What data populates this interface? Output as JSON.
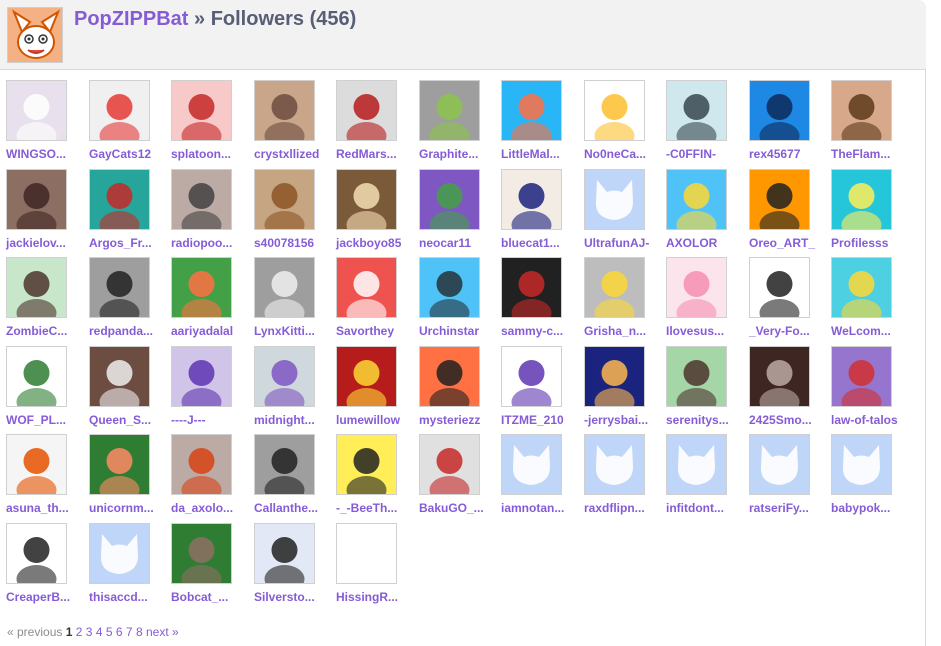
{
  "header": {
    "username": "PopZIPPBat",
    "title_rest": " » Followers (456)",
    "avatar_icon": "cartoon-bat-avatar"
  },
  "colors": {
    "link": "#855cd6",
    "text": "#575e75",
    "default_avatar_bg": "#c0d6f9"
  },
  "followers": [
    {
      "name": "WINGSO...",
      "bg": "#e8e0ec",
      "fg": "#ffffff"
    },
    {
      "name": "GayCats12",
      "bg": "#f0f0f0",
      "fg": "#e53935"
    },
    {
      "name": "splatoon...",
      "bg": "#f7c9c9",
      "fg": "#c62828"
    },
    {
      "name": "crystxllized",
      "bg": "#c9a58a",
      "fg": "#6d4c41"
    },
    {
      "name": "RedMars...",
      "bg": "#dcdcdc",
      "fg": "#b71c1c"
    },
    {
      "name": "Graphite...",
      "bg": "#9e9e9e",
      "fg": "#8bc34a"
    },
    {
      "name": "LittleMal...",
      "bg": "#29b6f6",
      "fg": "#ff7043"
    },
    {
      "name": "No0neCa...",
      "bg": "#ffffff",
      "fg": "#fbc02d"
    },
    {
      "name": "-C0FFIN-",
      "bg": "#cfe8ee",
      "fg": "#37474f"
    },
    {
      "name": "rex45677",
      "bg": "#1e88e5",
      "fg": "#0d2a5a"
    },
    {
      "name": "TheFlam...",
      "bg": "#d7a98a",
      "fg": "#5d3a1a"
    },
    {
      "name": "jackielov...",
      "bg": "#8d6e63",
      "fg": "#3e2723"
    },
    {
      "name": "Argos_Fr...",
      "bg": "#26a69a",
      "fg": "#c62828"
    },
    {
      "name": "radiopoo...",
      "bg": "#bcaaa4",
      "fg": "#424242"
    },
    {
      "name": "s40078156",
      "bg": "#c5a582",
      "fg": "#8d5524"
    },
    {
      "name": "jackboyo85",
      "bg": "#7b5a3a",
      "fg": "#f5deb3"
    },
    {
      "name": "neocar11",
      "bg": "#7e57c2",
      "fg": "#43a047"
    },
    {
      "name": "bluecat1...",
      "bg": "#f3ece4",
      "fg": "#1a237e"
    },
    {
      "name": "UltrafunAJ-",
      "bg": "default",
      "fg": "#ffffff"
    },
    {
      "name": "AXOLOR",
      "bg": "#4fc3f7",
      "fg": "#fdd835"
    },
    {
      "name": "Oreo_ART_",
      "bg": "#ff9800",
      "fg": "#212121"
    },
    {
      "name": "Profilesss",
      "bg": "#26c6da",
      "fg": "#ffee58"
    },
    {
      "name": "ZombieC...",
      "bg": "#c8e6c9",
      "fg": "#4e342e"
    },
    {
      "name": "redpanda...",
      "bg": "#9e9e9e",
      "fg": "#212121"
    },
    {
      "name": "aariyadalal",
      "bg": "#43a047",
      "fg": "#ff7043"
    },
    {
      "name": "LynxKitti...",
      "bg": "#9e9e9e",
      "fg": "#eeeeee"
    },
    {
      "name": "Savorthey",
      "bg": "#ef5350",
      "fg": "#ffffff"
    },
    {
      "name": "Urchinstar",
      "bg": "#4fc3f7",
      "fg": "#263238"
    },
    {
      "name": "sammy-c...",
      "bg": "#212121",
      "fg": "#c62828"
    },
    {
      "name": "Grisha_n...",
      "bg": "#bdbdbd",
      "fg": "#fdd835"
    },
    {
      "name": "Ilovesus...",
      "bg": "#fce4ec",
      "fg": "#f48fb1"
    },
    {
      "name": "_Very-Fo...",
      "bg": "#ffffff",
      "fg": "#212121"
    },
    {
      "name": "WeLcom...",
      "bg": "#4dd0e1",
      "fg": "#fdd835"
    },
    {
      "name": "WOF_PL...",
      "bg": "#ffffff",
      "fg": "#2e7d32"
    },
    {
      "name": "Queen_S...",
      "bg": "#6d4c41",
      "fg": "#eeeeee"
    },
    {
      "name": "----J---",
      "bg": "#d1c4e9",
      "fg": "#5e35b1"
    },
    {
      "name": "midnight...",
      "bg": "#cfd8dc",
      "fg": "#7e57c2"
    },
    {
      "name": "lumewillow",
      "bg": "#b71c1c",
      "fg": "#fdd835"
    },
    {
      "name": "mysteriezz",
      "bg": "#ff7043",
      "fg": "#212121"
    },
    {
      "name": "ITZME_210",
      "bg": "#ffffff",
      "fg": "#5e35b1"
    },
    {
      "name": "-jerrysbai...",
      "bg": "#1a237e",
      "fg": "#ffb74d"
    },
    {
      "name": "serenitys...",
      "bg": "#a5d6a7",
      "fg": "#4e342e"
    },
    {
      "name": "2425Smo...",
      "bg": "#3e2723",
      "fg": "#bcaaa4"
    },
    {
      "name": "law-of-talos",
      "bg": "#9575cd",
      "fg": "#d32f2f"
    },
    {
      "name": "asuna_th...",
      "bg": "#f5f5f5",
      "fg": "#e65100"
    },
    {
      "name": "unicornm...",
      "bg": "#2e7d32",
      "fg": "#ff8a65"
    },
    {
      "name": "da_axolo...",
      "bg": "#bcaaa4",
      "fg": "#d84315"
    },
    {
      "name": "Callanthe...",
      "bg": "#9e9e9e",
      "fg": "#212121"
    },
    {
      "name": "-_-BeeTh...",
      "bg": "#ffee58",
      "fg": "#212121"
    },
    {
      "name": "BakuGO_...",
      "bg": "#e0e0e0",
      "fg": "#c62828"
    },
    {
      "name": "iamnotan...",
      "bg": "default",
      "fg": "#ffffff"
    },
    {
      "name": "raxdflipn...",
      "bg": "default",
      "fg": "#ffffff"
    },
    {
      "name": "infitdont...",
      "bg": "default",
      "fg": "#ffffff"
    },
    {
      "name": "ratseriFy...",
      "bg": "default",
      "fg": "#ffffff"
    },
    {
      "name": "babypok...",
      "bg": "default",
      "fg": "#ffffff"
    },
    {
      "name": "CreaperB...",
      "bg": "#ffffff",
      "fg": "#212121"
    },
    {
      "name": "thisaccd...",
      "bg": "default",
      "fg": "#ffffff"
    },
    {
      "name": "Bobcat_...",
      "bg": "#2e7d32",
      "fg": "#8d6e63"
    },
    {
      "name": "Silversto...",
      "bg": "#e3e8f7",
      "fg": "#212121"
    },
    {
      "name": "HissingR...",
      "bg": "#ffffff",
      "fg": "#ffffff"
    }
  ],
  "pagination": {
    "previous": "« previous",
    "current": "1",
    "pages": [
      "2",
      "3",
      "4",
      "5",
      "6",
      "7",
      "8"
    ],
    "next": "next »"
  }
}
